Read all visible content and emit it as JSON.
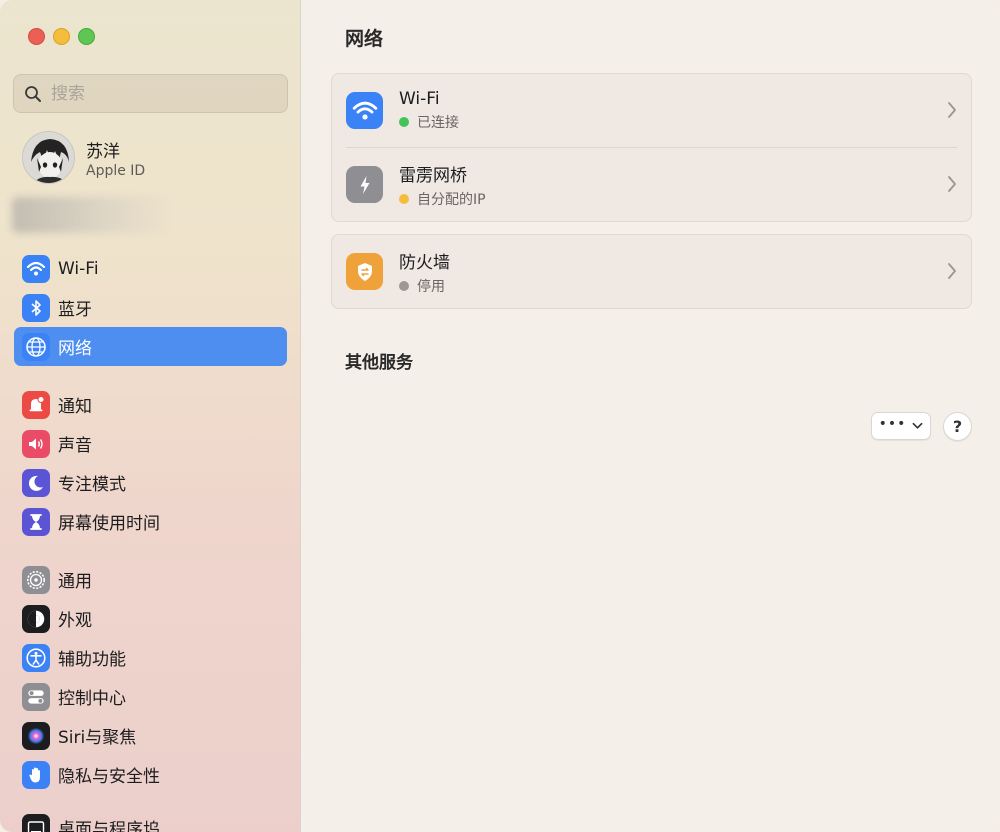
{
  "window": {
    "title": "网络"
  },
  "search": {
    "placeholder": "搜索"
  },
  "profile": {
    "name": "苏洋",
    "subtitle": "Apple ID"
  },
  "sidebar": {
    "items": [
      {
        "label": "Wi-Fi",
        "icon": "wifi-icon",
        "color": "#3a82f6"
      },
      {
        "label": "蓝牙",
        "icon": "bluetooth-icon",
        "color": "#3a82f6"
      },
      {
        "label": "网络",
        "icon": "globe-icon",
        "color": "#3a82f6",
        "active": true
      },
      {
        "label": "通知",
        "icon": "bell-icon",
        "color": "#ec4b45"
      },
      {
        "label": "声音",
        "icon": "speaker-icon",
        "color": "#ea4b67"
      },
      {
        "label": "专注模式",
        "icon": "moon-icon",
        "color": "#5b55d6"
      },
      {
        "label": "屏幕使用时间",
        "icon": "hourglass-icon",
        "color": "#5b55d6"
      },
      {
        "label": "通用",
        "icon": "gear-icon",
        "color": "#8e8e93"
      },
      {
        "label": "外观",
        "icon": "appearance-icon",
        "color": "#1d1d1f"
      },
      {
        "label": "辅助功能",
        "icon": "accessibility-icon",
        "color": "#3a82f6"
      },
      {
        "label": "控制中心",
        "icon": "toggles-icon",
        "color": "#8e8e93"
      },
      {
        "label": "Siri与聚焦",
        "icon": "siri-icon",
        "color": "#1d1d1f"
      },
      {
        "label": "隐私与安全性",
        "icon": "hand-icon",
        "color": "#3a82f6"
      },
      {
        "label": "桌面与程序坞",
        "icon": "dock-icon",
        "color": "#1d1d1f"
      }
    ]
  },
  "main": {
    "title": "网络",
    "services": [
      {
        "title": "Wi-Fi",
        "status": "已连接",
        "status_color": "#43c45a",
        "icon": "wifi-icon",
        "icon_color": "#3a82f6"
      },
      {
        "title": "雷雳网桥",
        "status": "自分配的IP",
        "status_color": "#f4be3c",
        "icon": "thunderbolt-icon",
        "icon_color": "#8e8e93"
      },
      {
        "title": "防火墙",
        "status": "停用",
        "status_color": "#9c9893",
        "icon": "firewall-icon",
        "icon_color": "#f0a23a"
      }
    ],
    "other_section_title": "其他服务",
    "more_button": "•••",
    "help_button": "?"
  }
}
